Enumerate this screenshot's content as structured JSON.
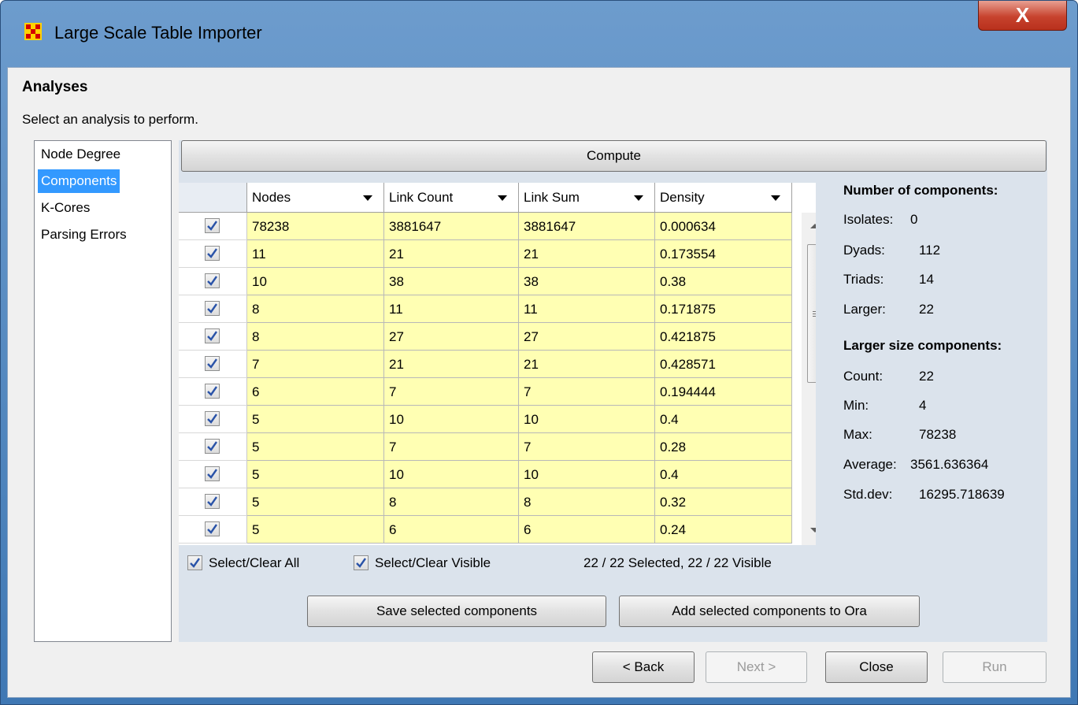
{
  "window": {
    "title": "Large Scale Table Importer",
    "close_glyph": "X"
  },
  "header": {
    "title": "Analyses",
    "subtitle": "Select an analysis to perform."
  },
  "sidebar": {
    "items": [
      {
        "label": "Node Degree"
      },
      {
        "label": "Components"
      },
      {
        "label": "K-Cores"
      },
      {
        "label": "Parsing Errors"
      }
    ],
    "selected": "Components"
  },
  "compute_label": "Compute",
  "table": {
    "columns": [
      "Nodes",
      "Link Count",
      "Link Sum",
      "Density"
    ],
    "rows": [
      [
        "78238",
        "3881647",
        "3881647",
        "0.000634"
      ],
      [
        "11",
        "21",
        "21",
        "0.173554"
      ],
      [
        "10",
        "38",
        "38",
        "0.38"
      ],
      [
        "8",
        "11",
        "11",
        "0.171875"
      ],
      [
        "8",
        "27",
        "27",
        "0.421875"
      ],
      [
        "7",
        "21",
        "21",
        "0.428571"
      ],
      [
        "6",
        "7",
        "7",
        "0.194444"
      ],
      [
        "5",
        "10",
        "10",
        "0.4"
      ],
      [
        "5",
        "7",
        "7",
        "0.28"
      ],
      [
        "5",
        "10",
        "10",
        "0.4"
      ],
      [
        "5",
        "8",
        "8",
        "0.32"
      ],
      [
        "5",
        "6",
        "6",
        "0.24"
      ]
    ],
    "row_checked": true
  },
  "select_all_label": "Select/Clear All",
  "select_visible_label": "Select/Clear Visible",
  "selection_status": "22 / 22 Selected, 22 / 22 Visible",
  "save_button_label": "Save selected components",
  "add_button_label": "Add selected components to Ora",
  "stats": {
    "num_heading": "Number of components:",
    "counts": [
      {
        "label": "Isolates:",
        "value": "0"
      },
      {
        "label": "Dyads:",
        "value": "112"
      },
      {
        "label": "Triads:",
        "value": "14"
      },
      {
        "label": "Larger:",
        "value": "22"
      }
    ],
    "larger_heading": "Larger size components:",
    "larger": [
      {
        "label": "Count:",
        "value": "22"
      },
      {
        "label": "Min:",
        "value": "4"
      },
      {
        "label": "Max:",
        "value": "78238"
      },
      {
        "label": "Average:",
        "value": "3561.636364"
      },
      {
        "label": "Std.dev:",
        "value": "16295.718639"
      }
    ]
  },
  "footer": {
    "back": "< Back",
    "next": "Next >",
    "close": "Close",
    "run": "Run"
  }
}
